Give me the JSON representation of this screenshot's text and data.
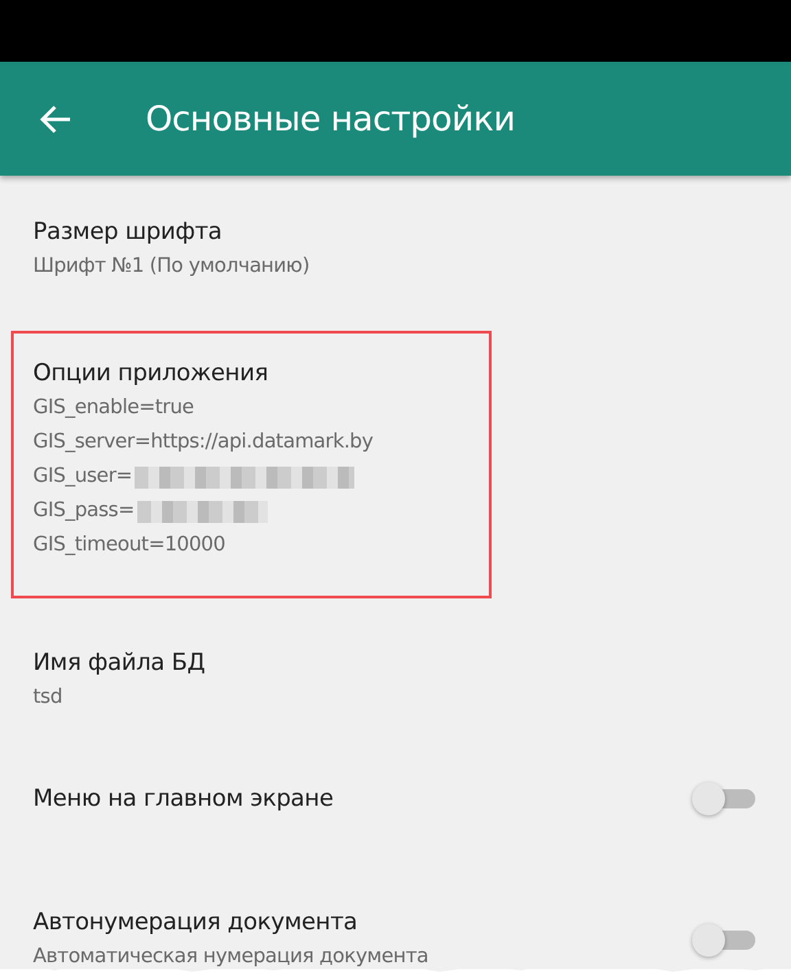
{
  "app_bar": {
    "title": "Основные настройки"
  },
  "settings": [
    {
      "kind": "text",
      "title": "Размер шрифта",
      "summary": [
        "Шрифт №1 (По умолчанию)"
      ],
      "annotated": false
    },
    {
      "kind": "text",
      "title": "Опции приложения",
      "summary": [
        "GIS_enable=true",
        "GIS_server=https://api.datamark.by",
        "GIS_user=",
        "GIS_pass=",
        "GIS_timeout=10000"
      ],
      "redacted": [
        false,
        false,
        true,
        true,
        false
      ],
      "annotated": true
    },
    {
      "kind": "text",
      "title": "Имя файла БД",
      "summary": [
        "tsd"
      ],
      "annotated": false
    },
    {
      "kind": "switch",
      "title": "Меню на главном экране",
      "on": false,
      "annotated": false
    },
    {
      "kind": "switch",
      "title": "Автонумерация документа",
      "summary": [
        "Автоматическая нумерация документа"
      ],
      "on": false,
      "annotated": false
    }
  ]
}
